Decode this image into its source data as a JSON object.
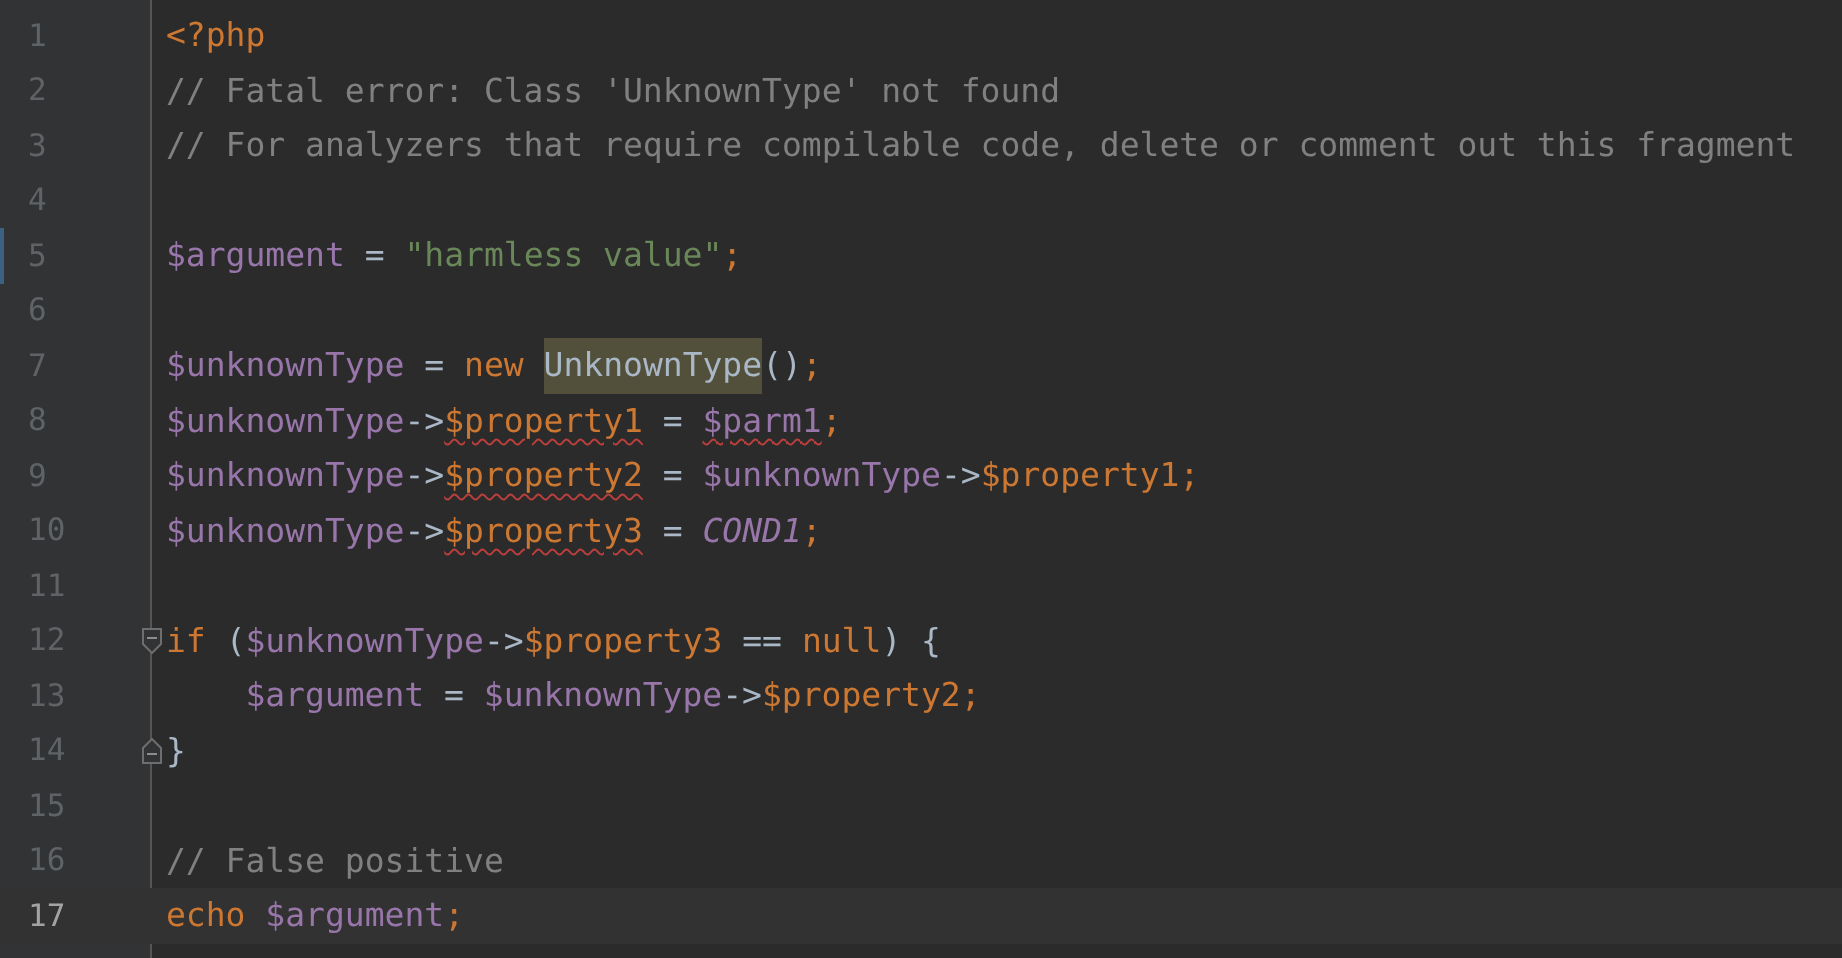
{
  "editor": {
    "lines": [
      {
        "number": "1",
        "kind": "plain",
        "current": false,
        "modified": false,
        "tokens": [
          {
            "kind": "keyword",
            "text": "<?php",
            "error": false,
            "highlighted": false
          }
        ]
      },
      {
        "number": "2",
        "kind": "plain",
        "current": false,
        "modified": false,
        "tokens": [
          {
            "kind": "comment",
            "text": "// Fatal error: Class 'UnknownType' not found",
            "error": false,
            "highlighted": false
          }
        ]
      },
      {
        "number": "3",
        "kind": "plain",
        "current": false,
        "modified": false,
        "tokens": [
          {
            "kind": "comment",
            "text": "// For analyzers that require compilable code, delete or comment out this fragment",
            "error": false,
            "highlighted": false
          }
        ]
      },
      {
        "number": "4",
        "kind": "plain",
        "current": false,
        "modified": false
      },
      {
        "number": "5",
        "kind": "plain",
        "current": false,
        "modified": true,
        "tokens": [
          {
            "kind": "variable",
            "text": "$argument",
            "error": false,
            "highlighted": false
          },
          {
            "kind": "plain",
            "text": " = ",
            "error": false,
            "highlighted": false
          },
          {
            "kind": "string",
            "text": "\"harmless value\"",
            "error": false,
            "highlighted": false
          },
          {
            "kind": "keyword",
            "text": ";",
            "error": false,
            "highlighted": false
          }
        ]
      },
      {
        "number": "6",
        "kind": "plain",
        "current": false,
        "modified": false
      },
      {
        "number": "7",
        "kind": "plain",
        "current": false,
        "modified": false,
        "tokens": [
          {
            "kind": "variable",
            "text": "$unknownType",
            "error": false,
            "highlighted": false
          },
          {
            "kind": "plain",
            "text": " = ",
            "error": false,
            "highlighted": false
          },
          {
            "kind": "keyword",
            "text": "new ",
            "error": false,
            "highlighted": false
          },
          {
            "kind": "plain",
            "text": "UnknownType",
            "error": false,
            "highlighted": true
          },
          {
            "kind": "plain",
            "text": "()",
            "error": false,
            "highlighted": false
          },
          {
            "kind": "keyword",
            "text": ";",
            "error": false,
            "highlighted": false
          }
        ]
      },
      {
        "number": "8",
        "kind": "plain",
        "current": false,
        "modified": false,
        "tokens": [
          {
            "kind": "variable",
            "text": "$unknownType",
            "error": false,
            "highlighted": false
          },
          {
            "kind": "plain",
            "text": "->",
            "error": false,
            "highlighted": false
          },
          {
            "kind": "property",
            "text": "$property1",
            "error": true,
            "highlighted": false
          },
          {
            "kind": "plain",
            "text": " = ",
            "error": false,
            "highlighted": false
          },
          {
            "kind": "variable",
            "text": "$parm1",
            "error": true,
            "highlighted": false
          },
          {
            "kind": "keyword",
            "text": ";",
            "error": false,
            "highlighted": false
          }
        ]
      },
      {
        "number": "9",
        "kind": "plain",
        "current": false,
        "modified": false,
        "tokens": [
          {
            "kind": "variable",
            "text": "$unknownType",
            "error": false,
            "highlighted": false
          },
          {
            "kind": "plain",
            "text": "->",
            "error": false,
            "highlighted": false
          },
          {
            "kind": "property",
            "text": "$property2",
            "error": true,
            "highlighted": false
          },
          {
            "kind": "plain",
            "text": " = ",
            "error": false,
            "highlighted": false
          },
          {
            "kind": "variable",
            "text": "$unknownType",
            "error": false,
            "highlighted": false
          },
          {
            "kind": "plain",
            "text": "->",
            "error": false,
            "highlighted": false
          },
          {
            "kind": "property",
            "text": "$property1",
            "error": false,
            "highlighted": false
          },
          {
            "kind": "keyword",
            "text": ";",
            "error": false,
            "highlighted": false
          }
        ]
      },
      {
        "number": "10",
        "kind": "plain",
        "current": false,
        "modified": false,
        "tokens": [
          {
            "kind": "variable",
            "text": "$unknownType",
            "error": false,
            "highlighted": false
          },
          {
            "kind": "plain",
            "text": "->",
            "error": false,
            "highlighted": false
          },
          {
            "kind": "property",
            "text": "$property3",
            "error": true,
            "highlighted": false
          },
          {
            "kind": "plain",
            "text": " = ",
            "error": false,
            "highlighted": false
          },
          {
            "kind": "constant",
            "text": "COND1",
            "error": false,
            "highlighted": false
          },
          {
            "kind": "keyword",
            "text": ";",
            "error": false,
            "highlighted": false
          }
        ]
      },
      {
        "number": "11",
        "kind": "plain",
        "current": false,
        "modified": false
      },
      {
        "number": "12",
        "kind": "fold-start",
        "current": false,
        "modified": false,
        "tokens": [
          {
            "kind": "keyword",
            "text": "if ",
            "error": false,
            "highlighted": false
          },
          {
            "kind": "plain",
            "text": "(",
            "error": false,
            "highlighted": false
          },
          {
            "kind": "variable",
            "text": "$unknownType",
            "error": false,
            "highlighted": false
          },
          {
            "kind": "plain",
            "text": "->",
            "error": false,
            "highlighted": false
          },
          {
            "kind": "property",
            "text": "$property3",
            "error": false,
            "highlighted": false
          },
          {
            "kind": "plain",
            "text": " == ",
            "error": false,
            "highlighted": false
          },
          {
            "kind": "keyword",
            "text": "null",
            "error": false,
            "highlighted": false
          },
          {
            "kind": "plain",
            "text": ") {",
            "error": false,
            "highlighted": false
          }
        ],
        "children": [
          {
            "number": "13",
            "current": false,
            "modified": false,
            "tokens": [
              {
                "kind": "variable",
                "text": "$argument",
                "error": false,
                "highlighted": false
              },
              {
                "kind": "plain",
                "text": " = ",
                "error": false,
                "highlighted": false
              },
              {
                "kind": "variable",
                "text": "$unknownType",
                "error": false,
                "highlighted": false
              },
              {
                "kind": "plain",
                "text": "->",
                "error": false,
                "highlighted": false
              },
              {
                "kind": "property",
                "text": "$property2",
                "error": false,
                "highlighted": false
              },
              {
                "kind": "keyword",
                "text": ";",
                "error": false,
                "highlighted": false
              }
            ]
          }
        ]
      },
      {
        "number": "14",
        "kind": "fold-end",
        "current": false,
        "modified": false,
        "tokens": [
          {
            "kind": "plain",
            "text": "}",
            "error": false,
            "highlighted": false
          }
        ]
      },
      {
        "number": "15",
        "kind": "plain",
        "current": false,
        "modified": false
      },
      {
        "number": "16",
        "kind": "plain",
        "current": false,
        "modified": false,
        "tokens": [
          {
            "kind": "comment",
            "text": "// False positive",
            "error": false,
            "highlighted": false
          }
        ]
      },
      {
        "number": "17",
        "kind": "plain",
        "current": true,
        "modified": false,
        "tokens": [
          {
            "kind": "keyword",
            "text": "echo ",
            "error": false,
            "highlighted": false
          },
          {
            "kind": "variable",
            "text": "$argument",
            "error": false,
            "highlighted": false
          },
          {
            "kind": "keyword",
            "text": ";",
            "error": false,
            "highlighted": false
          }
        ]
      }
    ]
  }
}
